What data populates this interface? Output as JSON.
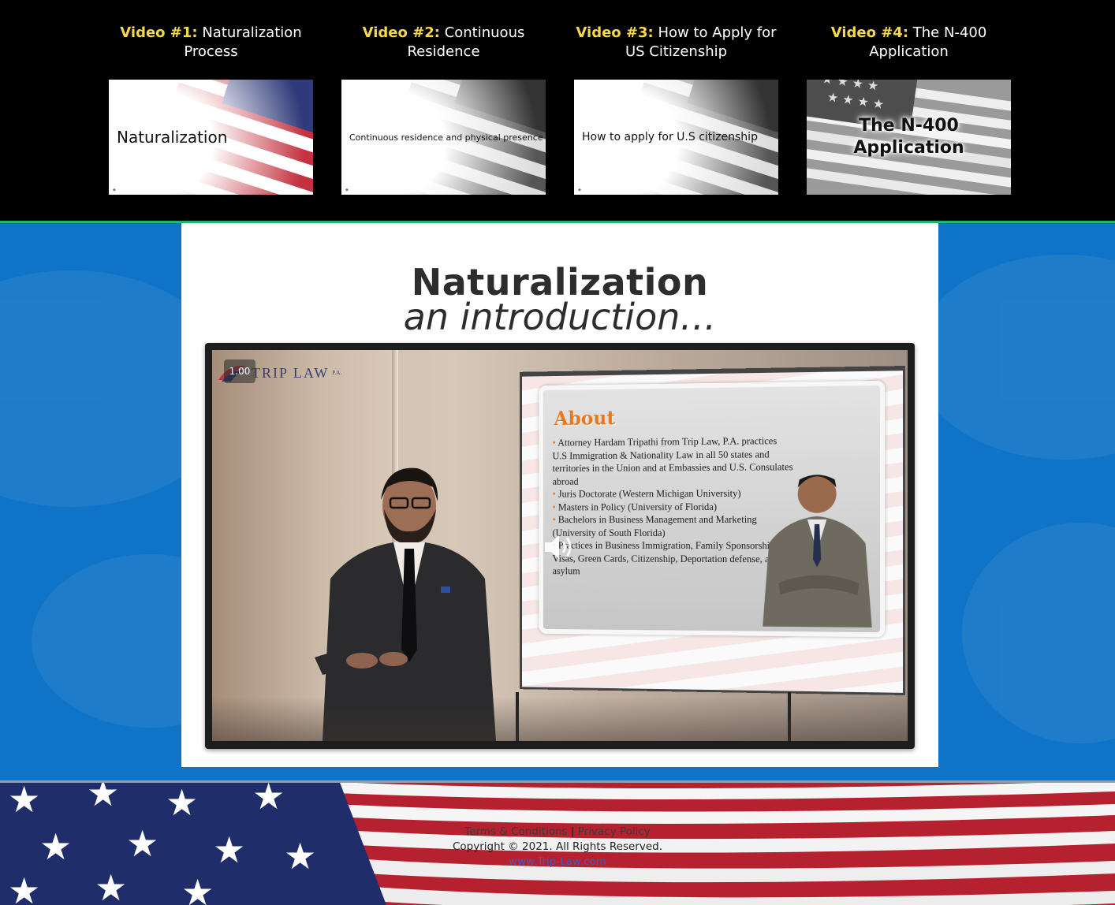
{
  "videos": [
    {
      "num": "Video #1:",
      "title": "Naturalization Process",
      "thumb_text": "Naturalization"
    },
    {
      "num": "Video #2:",
      "title": "Continuous Residence",
      "thumb_text": "Continuous residence and physical presence"
    },
    {
      "num": "Video #3:",
      "title": "How to Apply for US Citizenship",
      "thumb_text": "How to apply for U.S citizenship"
    },
    {
      "num": "Video #4:",
      "title": "The N-400 Application",
      "thumb_text": "The N-400 Application"
    }
  ],
  "main": {
    "title": "Naturalization",
    "subtitle": "an introduction…"
  },
  "player": {
    "speed": "1.00",
    "logo_text": "TRIP LAW",
    "logo_suffix": "P.A.",
    "slide_title": "About",
    "slide_lines": [
      "Attorney Hardam Tripathi from Trip Law, P.A. practices U.S Immigration & Nationality Law in all 50 states and territories in the Union and at Embassies and U.S. Consulates abroad",
      "Juris Doctorate (Western Michigan University)",
      "Masters in Policy (University of Florida)",
      "Bachelors in Business Management and Marketing (University of South Florida)",
      "Practices in Business Immigration, Family Sponsorship, Visas, Green Cards, Citizenship, Deportation defense, and asylum"
    ]
  },
  "footer": {
    "terms": "Terms & Conditions",
    "separator": "|",
    "privacy": "Privacy Policy",
    "copyright": "Copyright © 2021. All Rights Reserved.",
    "site": "www.Trip-Law.com"
  },
  "colors": {
    "accent_yellow": "#f5d94a",
    "blue_bg": "#0f73c8",
    "green_line": "#1fb37a",
    "slide_orange": "#e87722"
  },
  "icons": [
    "volume-icon",
    "flag-image",
    "trip-law-logo"
  ]
}
